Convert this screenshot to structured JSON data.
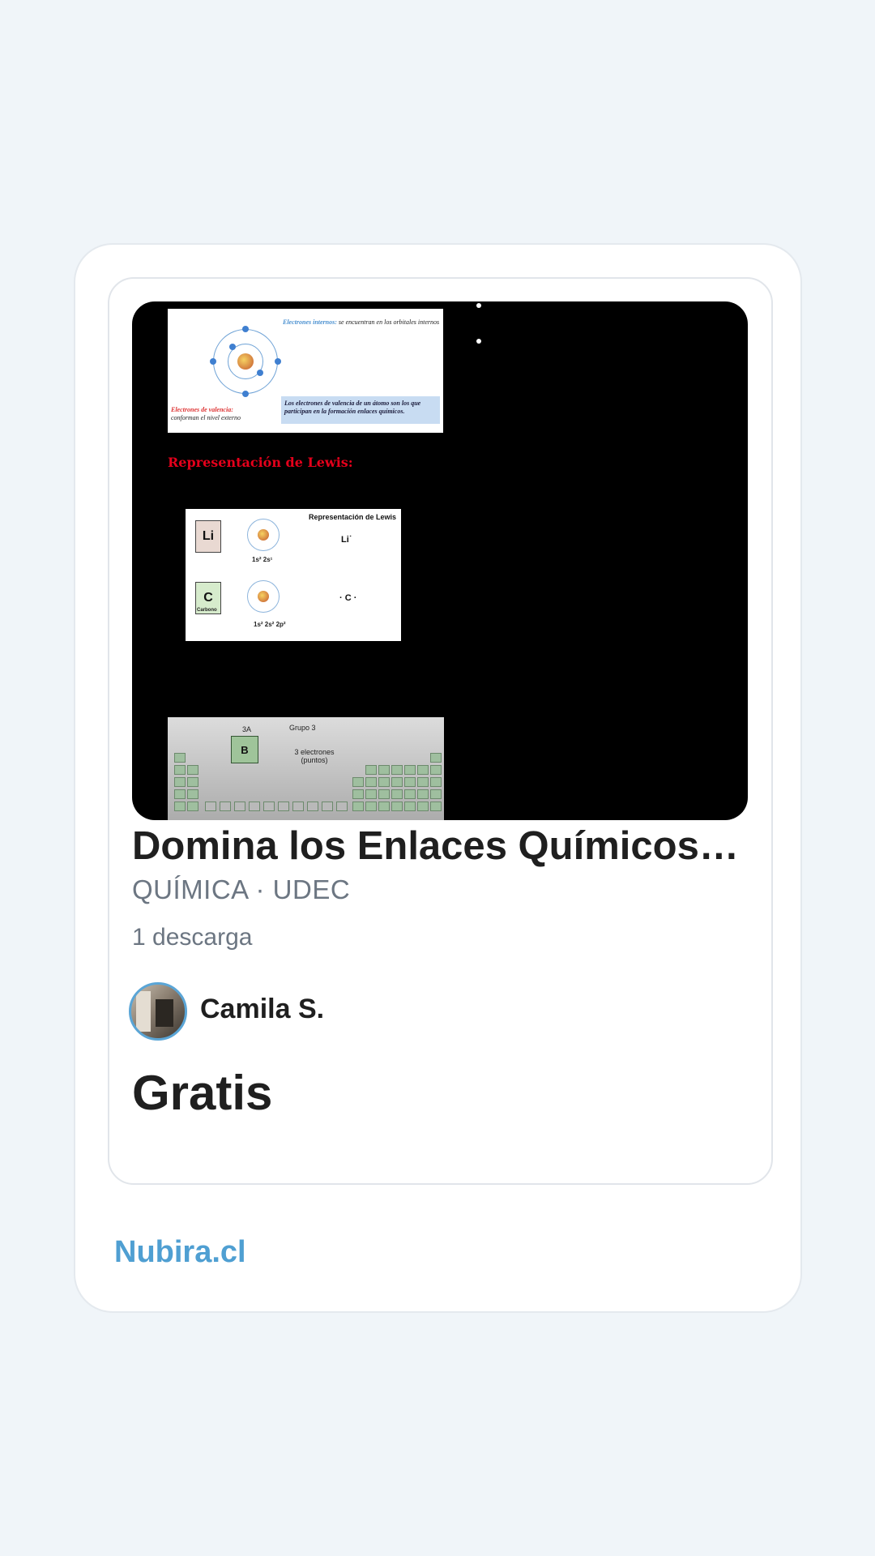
{
  "preview": {
    "atom_inner_label": "Electrones internos:",
    "atom_inner_text": "se encuentran en los orbitales internos",
    "atom_valence_label": "Electrones de valencia:",
    "atom_valence_text": "conforman el nivel externo",
    "atom_box_text": "Los electrones de valencia de un átomo son los que participan en la formación enlaces químicos.",
    "lewis_heading": "Representación de Lewis:",
    "lewis_panel_title": "Representación de Lewis",
    "li_symbol": "Li",
    "li_config": "1s² 2s¹",
    "li_lewis": "Li˙",
    "c_symbol": "C",
    "c_config": "1s² 2s² 2p²",
    "c_lewis": "· C ·",
    "c_name": "Carbono",
    "group_label_3a": "3A",
    "group_label": "Grupo 3",
    "boron_symbol": "B",
    "electrons_label": "3 electrones (puntos)"
  },
  "document": {
    "title": "Domina los Enlaces Químicos de Lewis",
    "subtitle": "QUÍMICA · UDEC",
    "downloads": "1 descarga"
  },
  "author": {
    "name": "Camila S."
  },
  "price": "Gratis",
  "brand": "Nubira.cl",
  "colors": {
    "brand": "#4f9fd2",
    "background": "#f0f5f9",
    "lewis_heading": "#e4001b"
  }
}
